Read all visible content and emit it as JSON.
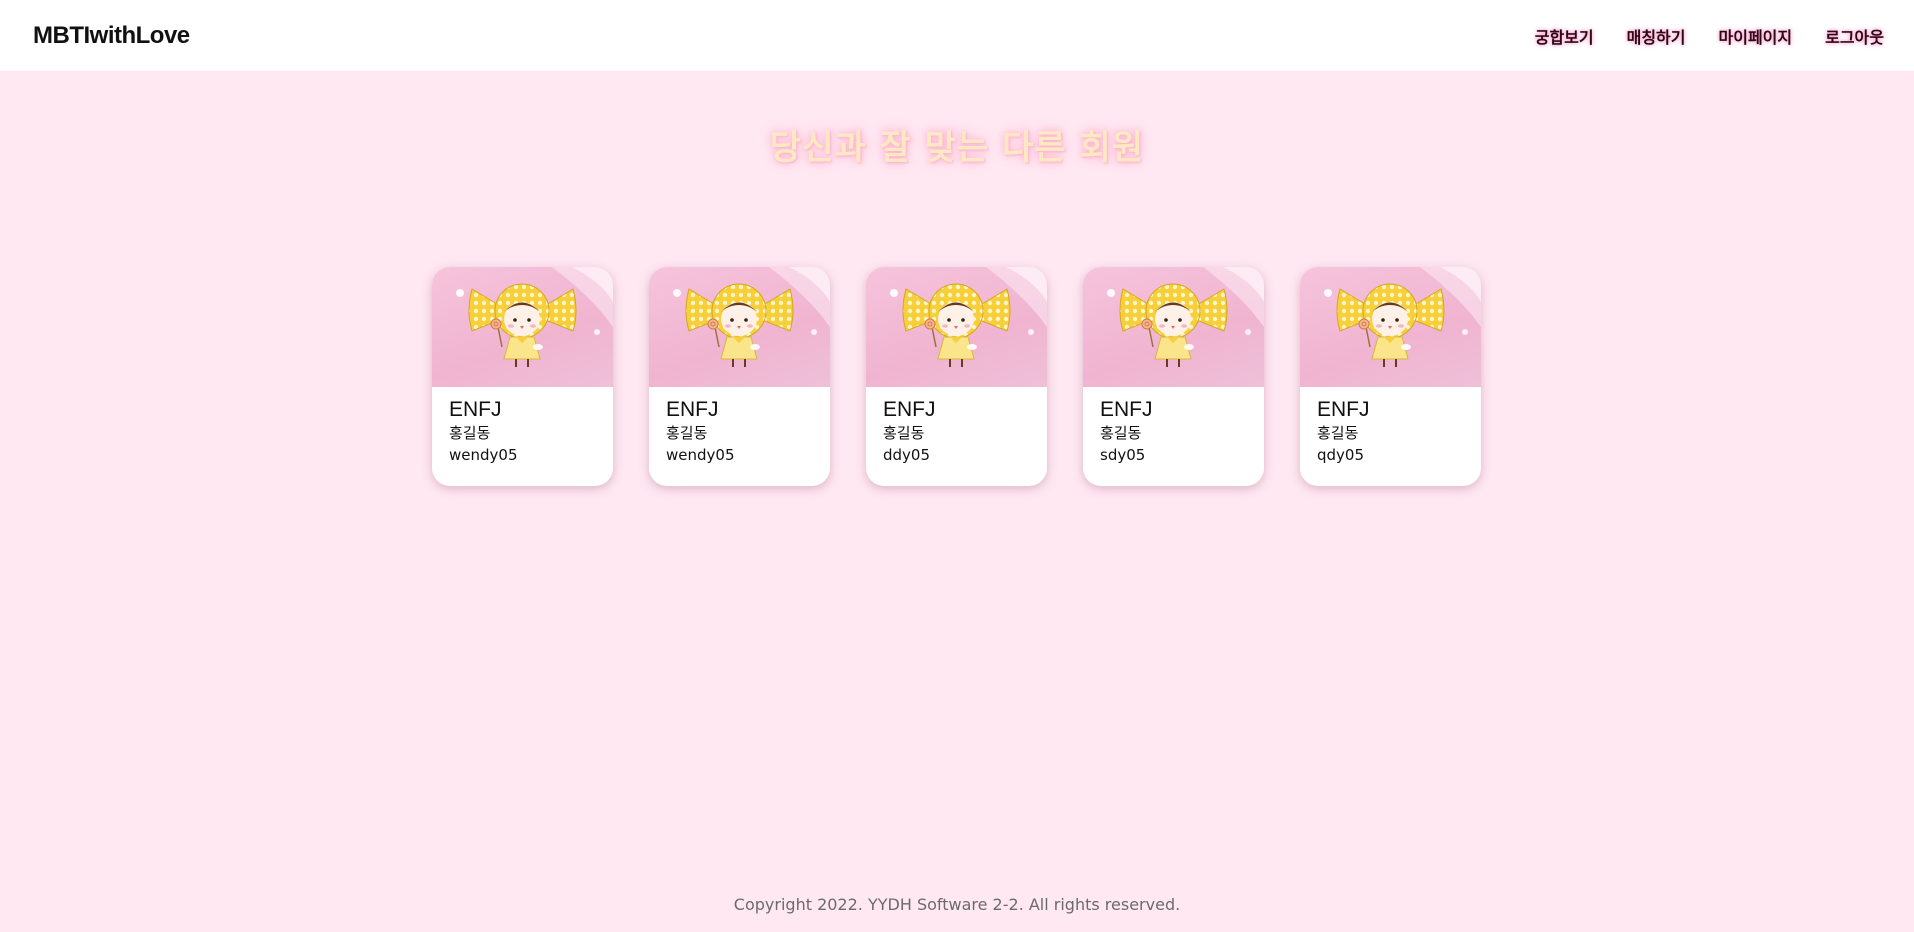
{
  "navbar": {
    "brand": "MBTIwithLove",
    "links": [
      {
        "label": "궁합보기"
      },
      {
        "label": "매칭하기"
      },
      {
        "label": "마이페이지"
      },
      {
        "label": "로그아웃"
      }
    ]
  },
  "main": {
    "heading": "당신과 잘 맞는 다른 회원",
    "members": [
      {
        "mbti": "ENFJ",
        "name": "홍길동",
        "id": "wendy05"
      },
      {
        "mbti": "ENFJ",
        "name": "홍길동",
        "id": "wendy05"
      },
      {
        "mbti": "ENFJ",
        "name": "홍길동",
        "id": "ddy05"
      },
      {
        "mbti": "ENFJ",
        "name": "홍길동",
        "id": "sdy05"
      },
      {
        "mbti": "ENFJ",
        "name": "홍길동",
        "id": "qdy05"
      }
    ]
  },
  "footer": {
    "copyright": "Copyright 2022. YYDH Software 2-2. All rights reserved."
  },
  "colors": {
    "page_background": "#ffe8f2",
    "navbar_background": "#ffffff",
    "heading_text": "#ffe9c4",
    "card_image_background": "#f4bfd8",
    "footer_text": "#6b6b6b"
  },
  "icons": {
    "card_image": "candy-girl-character-illustration"
  }
}
